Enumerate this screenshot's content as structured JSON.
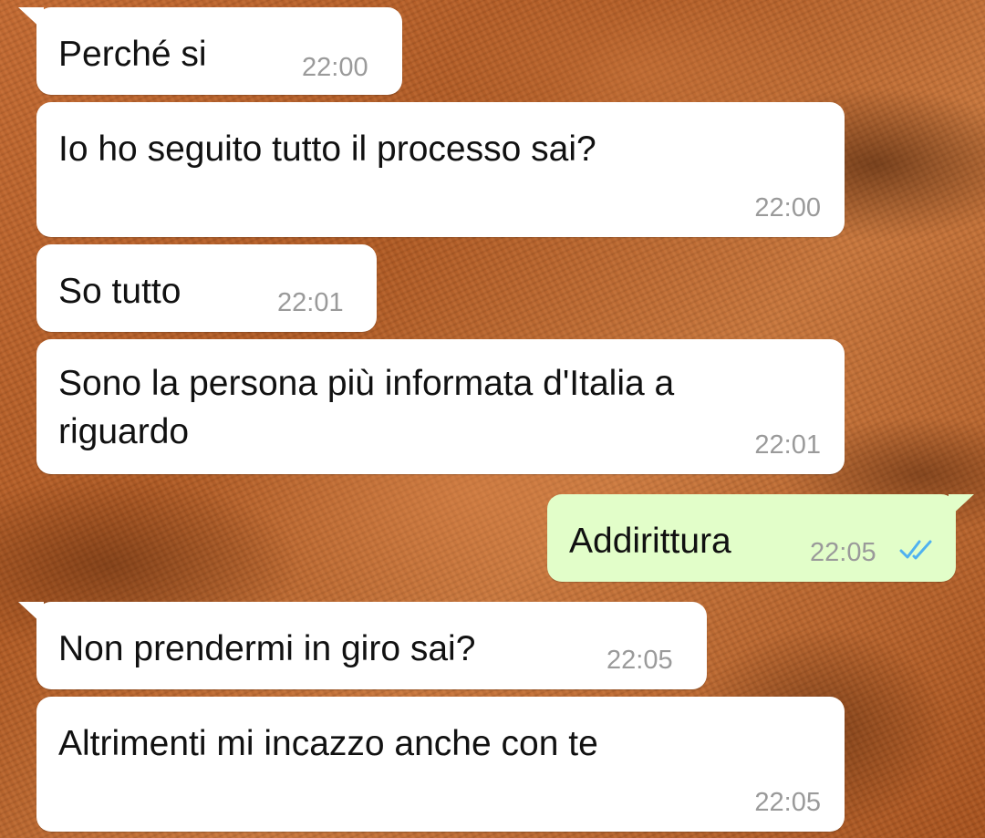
{
  "messages": [
    {
      "direction": "incoming",
      "text": "Perché si",
      "time": "22:00"
    },
    {
      "direction": "incoming",
      "text": "Io ho seguito tutto il processo sai?",
      "time": "22:00"
    },
    {
      "direction": "incoming",
      "text": "So tutto",
      "time": "22:01"
    },
    {
      "direction": "incoming",
      "text_line1": "Sono la persona più informata d'Italia a",
      "text_line2": "riguardo",
      "time": "22:01"
    },
    {
      "direction": "outgoing",
      "text": "Addirittura",
      "time": "22:05",
      "status": "read"
    },
    {
      "direction": "incoming",
      "text": "Non prendermi in giro sai?",
      "time": "22:05"
    },
    {
      "direction": "incoming",
      "text": "Altrimenti mi incazzo anche con te",
      "time": "22:05"
    }
  ],
  "colors": {
    "incoming_bubble": "#ffffff",
    "outgoing_bubble": "#e2fec9",
    "timestamp": "#9a9a9a",
    "read_ticks": "#4fb1f0",
    "wallpaper": "#b8622a"
  },
  "icons": {
    "read_status": "double-check-icon"
  }
}
